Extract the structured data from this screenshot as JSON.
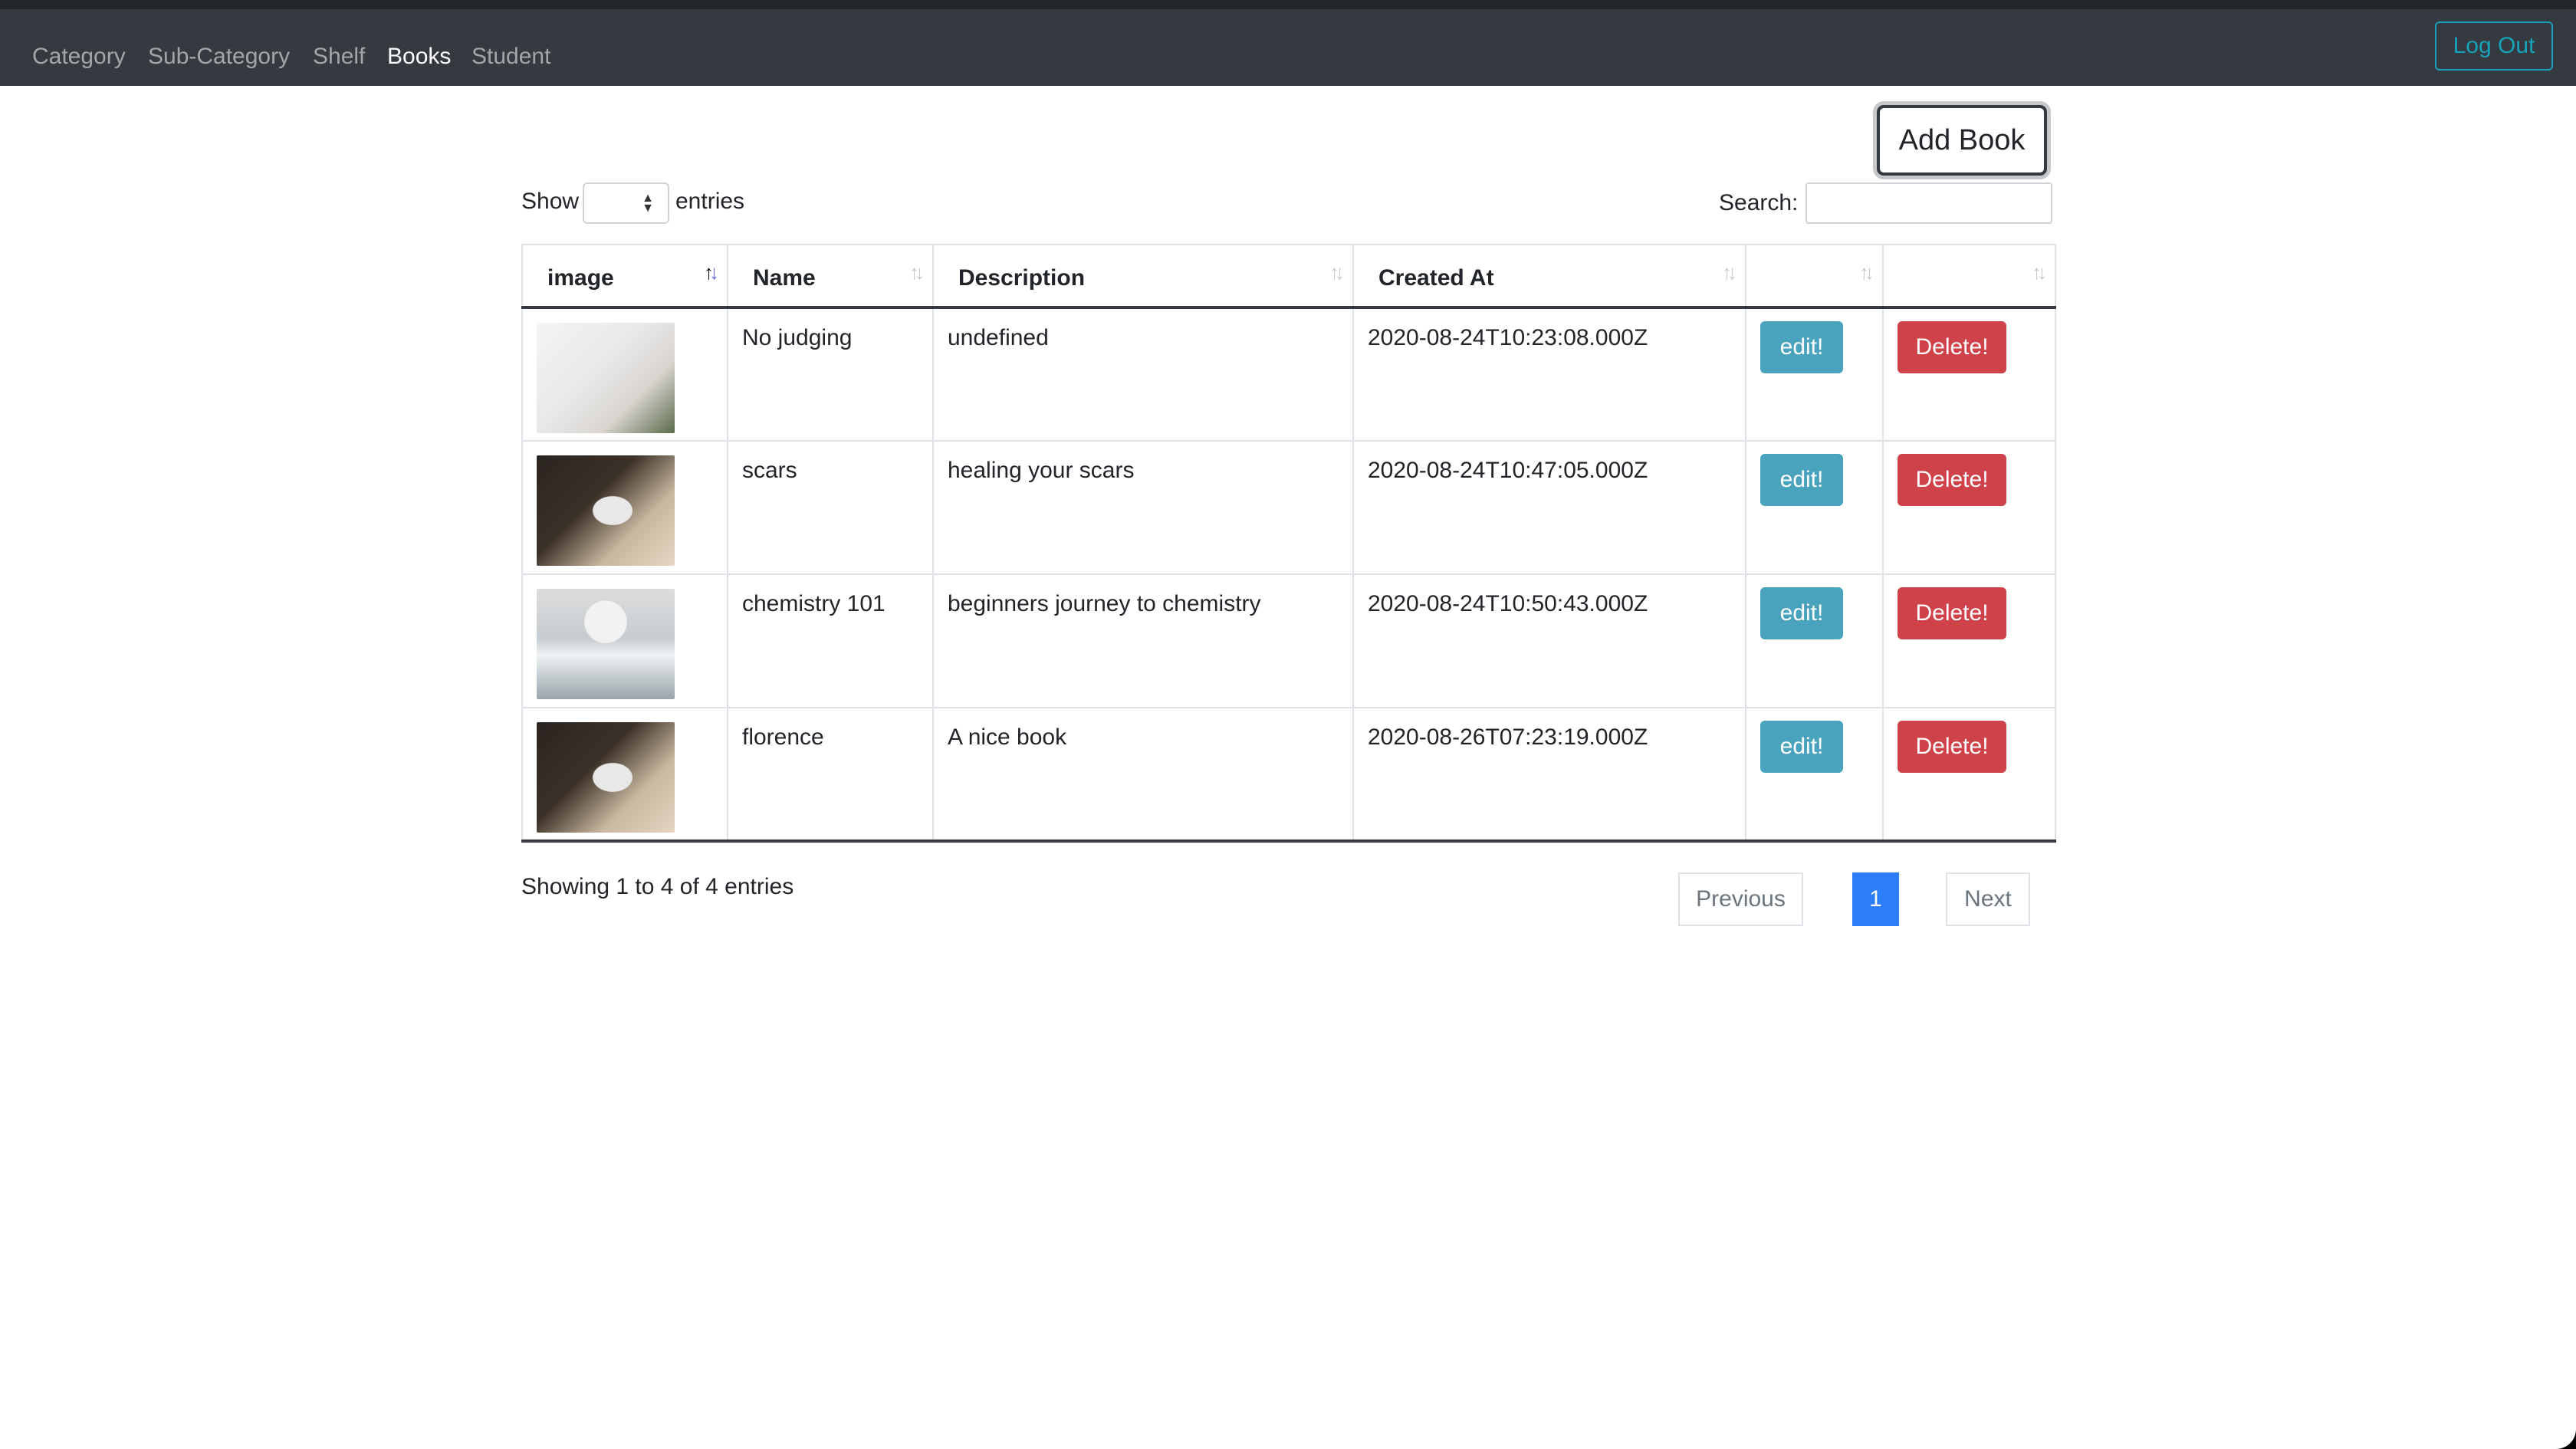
{
  "nav": {
    "items": [
      "Category",
      "Sub-Category",
      "Shelf",
      "Books",
      "Student"
    ],
    "active": "Books",
    "logout_label": "Log Out"
  },
  "toolbar": {
    "add_label": "Add Book"
  },
  "length": {
    "show_label": "Show",
    "entries_label": "entries",
    "selected": ""
  },
  "search": {
    "label": "Search:",
    "value": ""
  },
  "table": {
    "headers": [
      "image",
      "Name",
      "Description",
      "Created At",
      "",
      ""
    ],
    "sorted_column": "image",
    "rows": [
      {
        "image": "book-photo-light",
        "name": "No judging",
        "description": "undefined",
        "created": "2020-08-24T10:23:08.000Z",
        "edit": "edit!",
        "delete": "Delete!"
      },
      {
        "image": "book-photo-dark",
        "name": "scars",
        "description": "healing your scars",
        "created": "2020-08-24T10:47:05.000Z",
        "edit": "edit!",
        "delete": "Delete!"
      },
      {
        "image": "book-photo-white",
        "name": "chemistry 101",
        "description": "beginners journey to chemistry",
        "created": "2020-08-24T10:50:43.000Z",
        "edit": "edit!",
        "delete": "Delete!"
      },
      {
        "image": "book-photo-dark",
        "name": "florence",
        "description": "A nice book",
        "created": "2020-08-26T07:23:19.000Z",
        "edit": "edit!",
        "delete": "Delete!"
      }
    ]
  },
  "info": "Showing 1 to 4 of 4 entries",
  "pagination": {
    "previous": "Previous",
    "current": "1",
    "next": "Next"
  },
  "colors": {
    "navbar": "#343a40",
    "edit": "#4aa3bc",
    "delete": "#d0424a",
    "page_active": "#2c7ef8",
    "logout": "#17a2b8"
  }
}
